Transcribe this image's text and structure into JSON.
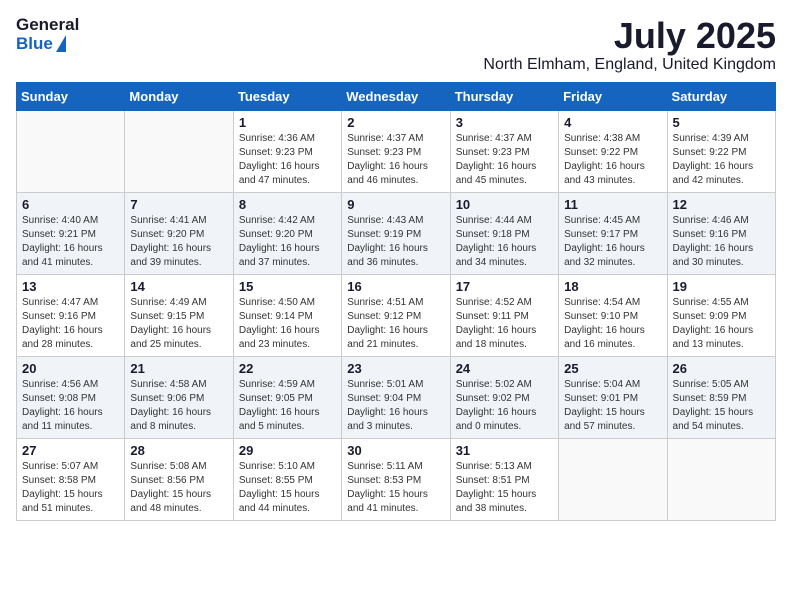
{
  "logo": {
    "general": "General",
    "blue": "Blue"
  },
  "title": "July 2025",
  "location": "North Elmham, England, United Kingdom",
  "headers": [
    "Sunday",
    "Monday",
    "Tuesday",
    "Wednesday",
    "Thursday",
    "Friday",
    "Saturday"
  ],
  "weeks": [
    [
      {
        "day": "",
        "info": ""
      },
      {
        "day": "",
        "info": ""
      },
      {
        "day": "1",
        "info": "Sunrise: 4:36 AM\nSunset: 9:23 PM\nDaylight: 16 hours\nand 47 minutes."
      },
      {
        "day": "2",
        "info": "Sunrise: 4:37 AM\nSunset: 9:23 PM\nDaylight: 16 hours\nand 46 minutes."
      },
      {
        "day": "3",
        "info": "Sunrise: 4:37 AM\nSunset: 9:23 PM\nDaylight: 16 hours\nand 45 minutes."
      },
      {
        "day": "4",
        "info": "Sunrise: 4:38 AM\nSunset: 9:22 PM\nDaylight: 16 hours\nand 43 minutes."
      },
      {
        "day": "5",
        "info": "Sunrise: 4:39 AM\nSunset: 9:22 PM\nDaylight: 16 hours\nand 42 minutes."
      }
    ],
    [
      {
        "day": "6",
        "info": "Sunrise: 4:40 AM\nSunset: 9:21 PM\nDaylight: 16 hours\nand 41 minutes."
      },
      {
        "day": "7",
        "info": "Sunrise: 4:41 AM\nSunset: 9:20 PM\nDaylight: 16 hours\nand 39 minutes."
      },
      {
        "day": "8",
        "info": "Sunrise: 4:42 AM\nSunset: 9:20 PM\nDaylight: 16 hours\nand 37 minutes."
      },
      {
        "day": "9",
        "info": "Sunrise: 4:43 AM\nSunset: 9:19 PM\nDaylight: 16 hours\nand 36 minutes."
      },
      {
        "day": "10",
        "info": "Sunrise: 4:44 AM\nSunset: 9:18 PM\nDaylight: 16 hours\nand 34 minutes."
      },
      {
        "day": "11",
        "info": "Sunrise: 4:45 AM\nSunset: 9:17 PM\nDaylight: 16 hours\nand 32 minutes."
      },
      {
        "day": "12",
        "info": "Sunrise: 4:46 AM\nSunset: 9:16 PM\nDaylight: 16 hours\nand 30 minutes."
      }
    ],
    [
      {
        "day": "13",
        "info": "Sunrise: 4:47 AM\nSunset: 9:16 PM\nDaylight: 16 hours\nand 28 minutes."
      },
      {
        "day": "14",
        "info": "Sunrise: 4:49 AM\nSunset: 9:15 PM\nDaylight: 16 hours\nand 25 minutes."
      },
      {
        "day": "15",
        "info": "Sunrise: 4:50 AM\nSunset: 9:14 PM\nDaylight: 16 hours\nand 23 minutes."
      },
      {
        "day": "16",
        "info": "Sunrise: 4:51 AM\nSunset: 9:12 PM\nDaylight: 16 hours\nand 21 minutes."
      },
      {
        "day": "17",
        "info": "Sunrise: 4:52 AM\nSunset: 9:11 PM\nDaylight: 16 hours\nand 18 minutes."
      },
      {
        "day": "18",
        "info": "Sunrise: 4:54 AM\nSunset: 9:10 PM\nDaylight: 16 hours\nand 16 minutes."
      },
      {
        "day": "19",
        "info": "Sunrise: 4:55 AM\nSunset: 9:09 PM\nDaylight: 16 hours\nand 13 minutes."
      }
    ],
    [
      {
        "day": "20",
        "info": "Sunrise: 4:56 AM\nSunset: 9:08 PM\nDaylight: 16 hours\nand 11 minutes."
      },
      {
        "day": "21",
        "info": "Sunrise: 4:58 AM\nSunset: 9:06 PM\nDaylight: 16 hours\nand 8 minutes."
      },
      {
        "day": "22",
        "info": "Sunrise: 4:59 AM\nSunset: 9:05 PM\nDaylight: 16 hours\nand 5 minutes."
      },
      {
        "day": "23",
        "info": "Sunrise: 5:01 AM\nSunset: 9:04 PM\nDaylight: 16 hours\nand 3 minutes."
      },
      {
        "day": "24",
        "info": "Sunrise: 5:02 AM\nSunset: 9:02 PM\nDaylight: 16 hours\nand 0 minutes."
      },
      {
        "day": "25",
        "info": "Sunrise: 5:04 AM\nSunset: 9:01 PM\nDaylight: 15 hours\nand 57 minutes."
      },
      {
        "day": "26",
        "info": "Sunrise: 5:05 AM\nSunset: 8:59 PM\nDaylight: 15 hours\nand 54 minutes."
      }
    ],
    [
      {
        "day": "27",
        "info": "Sunrise: 5:07 AM\nSunset: 8:58 PM\nDaylight: 15 hours\nand 51 minutes."
      },
      {
        "day": "28",
        "info": "Sunrise: 5:08 AM\nSunset: 8:56 PM\nDaylight: 15 hours\nand 48 minutes."
      },
      {
        "day": "29",
        "info": "Sunrise: 5:10 AM\nSunset: 8:55 PM\nDaylight: 15 hours\nand 44 minutes."
      },
      {
        "day": "30",
        "info": "Sunrise: 5:11 AM\nSunset: 8:53 PM\nDaylight: 15 hours\nand 41 minutes."
      },
      {
        "day": "31",
        "info": "Sunrise: 5:13 AM\nSunset: 8:51 PM\nDaylight: 15 hours\nand 38 minutes."
      },
      {
        "day": "",
        "info": ""
      },
      {
        "day": "",
        "info": ""
      }
    ]
  ]
}
